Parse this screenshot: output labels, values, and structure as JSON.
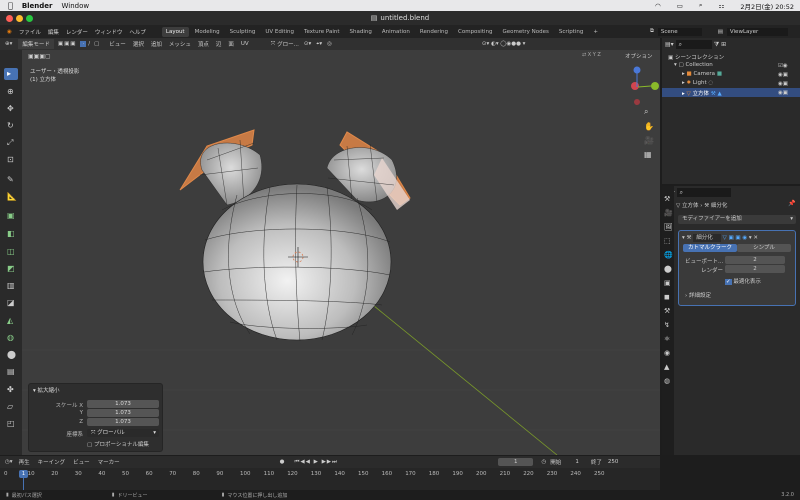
{
  "macbar": {
    "app": "Blender",
    "window_menu": "Window",
    "date": "2月2日(金) 20:52"
  },
  "window": {
    "title": "untitled.blend"
  },
  "topmenu": {
    "items": [
      "ファイル",
      "編集",
      "レンダー",
      "ウィンドウ",
      "ヘルプ"
    ],
    "workspaces": [
      "Layout",
      "Modeling",
      "Sculpting",
      "UV Editing",
      "Texture Paint",
      "Shading",
      "Animation",
      "Rendering",
      "Compositing",
      "Geometry Nodes",
      "Scripting"
    ],
    "add_tab": "+",
    "scene": "Scene",
    "viewlayer": "ViewLayer"
  },
  "viewport_header": {
    "mode": "編集モード",
    "menus": [
      "ビュー",
      "選択",
      "追加",
      "メッシュ",
      "頂点",
      "辺",
      "面",
      "UV"
    ],
    "transform": "グロー...",
    "options": "オプション"
  },
  "viewport": {
    "view_name": "ユーザー・透視投影",
    "object_label": "(1) 立方体"
  },
  "operator_panel": {
    "title": "拡大縮小",
    "scale_label": "スケール X",
    "y_label": "Y",
    "z_label": "Z",
    "scale_x": "1.073",
    "scale_y": "1.073",
    "scale_z": "1.073",
    "orient_label": "座標系",
    "orient_value": "グローバル",
    "proportional": "プロポーショナル編集"
  },
  "outliner": {
    "scene_collection": "シーンコレクション",
    "collection": "Collection",
    "camera": "Camera",
    "light": "Light",
    "cube": "立方体"
  },
  "properties": {
    "breadcrumb_obj": "立方体",
    "breadcrumb_mod": "細分化",
    "add_modifier": "モディファイアーを追加",
    "modifier_name": "細分化",
    "catmull": "カトマルクラーク",
    "simple": "シンプル",
    "viewport_label": "ビューポート...",
    "viewport_value": "2",
    "render_label": "レンダー",
    "render_value": "2",
    "optimal": "最適化表示",
    "advanced": "詳細設定"
  },
  "timeline": {
    "menus": [
      "再生",
      "キーイング",
      "ビュー",
      "マーカー"
    ],
    "current_frame": "1",
    "start_label": "開始",
    "start": "1",
    "end_label": "終了",
    "end": "250",
    "ticks": [
      "0",
      "10",
      "20",
      "30",
      "40",
      "50",
      "60",
      "70",
      "80",
      "90",
      "100",
      "110",
      "120",
      "130",
      "140",
      "150",
      "160",
      "170",
      "180",
      "190",
      "200",
      "210",
      "220",
      "230",
      "240",
      "250"
    ],
    "marker": "1"
  },
  "status": {
    "left": "最初パス選択",
    "mid": "ドリービュー",
    "right": "マウス位置に押し出し追加",
    "version": "3.2.0"
  }
}
